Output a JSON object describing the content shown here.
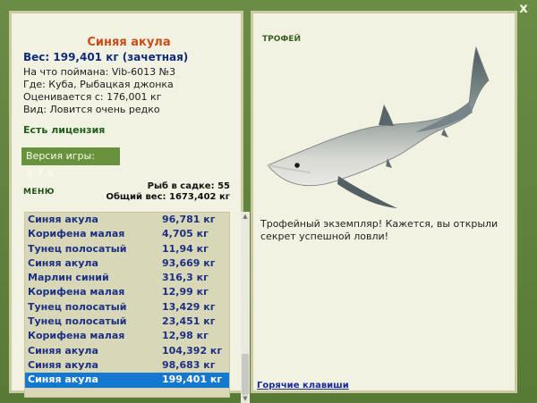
{
  "close": {
    "label": "x"
  },
  "catch": {
    "name": "Синяя акула",
    "weight": "Вес: 199,401 кг (зачетная)",
    "bait": "На что поймана: Vib-6013 №3",
    "location": "Где: Куба, Рыбацкая джонка",
    "value": "Оценивается с: 176,001 кг",
    "rarity": "Вид: Ловится очень редко"
  },
  "license": "Есть лицензия",
  "version": {
    "label": "Версия игры:",
    "value": "3.7.6"
  },
  "menu": "МЕНЮ",
  "stats": {
    "fish_in_cage": "Рыб в садке: 55",
    "total_weight": "Общий вес: 1673,402 кг"
  },
  "catches": [
    {
      "name": "Синяя акула",
      "weight": "96,781 кг"
    },
    {
      "name": "Корифена малая",
      "weight": "4,705 кг"
    },
    {
      "name": "Тунец полосатый",
      "weight": "11,94 кг"
    },
    {
      "name": "Синяя акула",
      "weight": "93,669 кг"
    },
    {
      "name": "Марлин синий",
      "weight": "316,3 кг"
    },
    {
      "name": "Корифена малая",
      "weight": "12,99 кг"
    },
    {
      "name": "Тунец полосатый",
      "weight": "13,429 кг"
    },
    {
      "name": "Тунец полосатый",
      "weight": "23,451 кг"
    },
    {
      "name": "Корифена малая",
      "weight": "12,98 кг"
    },
    {
      "name": "Синяя акула",
      "weight": "104,392 кг"
    },
    {
      "name": "Синяя акула",
      "weight": "98,683 кг"
    },
    {
      "name": "Синяя акула",
      "weight": "199,401 кг"
    }
  ],
  "selected_row": 11,
  "trophy": {
    "label": "ТРОФЕЙ",
    "description": "Трофейный экземпляр! Кажется, вы открыли секрет успешной ловли!"
  },
  "hotkeys": "Горячие клавиши",
  "colors": {
    "background": "#5d7e3b",
    "panel": "#f2f2e2",
    "accent": "#c84d16",
    "selection": "#1578d0"
  }
}
